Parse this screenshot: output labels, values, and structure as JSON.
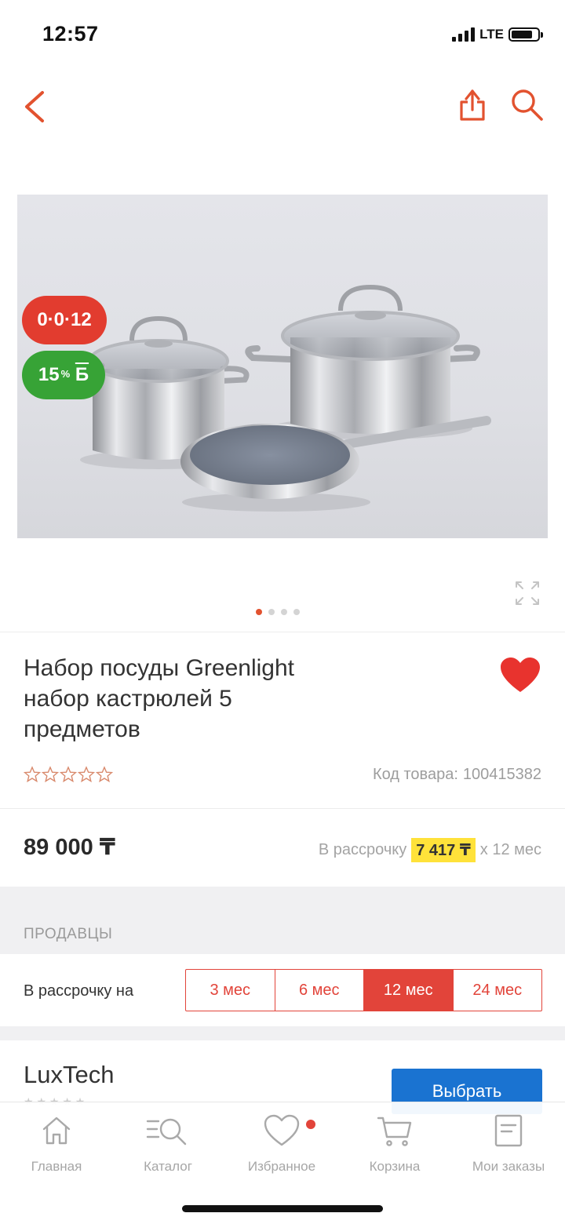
{
  "status_bar": {
    "time": "12:57",
    "network": "LTE"
  },
  "product": {
    "title": "Набор посуды Greenlight набор кастрюлей 5 предметов",
    "badges": {
      "installment": "0·0·12",
      "bonus_percent": "15",
      "bonus_unit": "%",
      "bonus_currency": "Б"
    },
    "gallery": {
      "image_count": 4,
      "active_index": 0
    },
    "rating": 0,
    "sku_label": "Код товара:",
    "sku_value": "100415382",
    "favorite": true,
    "price": "89 000 ₸",
    "installment_prefix": "В рассрочку",
    "installment_amount": "7 417 ₸",
    "installment_suffix": "x 12 мес"
  },
  "sellers": {
    "section_label": "ПРОДАВЦЫ",
    "term_label": "В рассрочку на",
    "terms": [
      "3 мес",
      "6 мес",
      "12 мес",
      "24 мес"
    ],
    "active_term_index": 2,
    "first_seller": {
      "name": "LuxTech",
      "button": "Выбрать"
    }
  },
  "tab_bar": {
    "items": [
      {
        "label": "Главная",
        "icon": "home-icon"
      },
      {
        "label": "Каталог",
        "icon": "catalog-search-icon"
      },
      {
        "label": "Избранное",
        "icon": "heart-icon"
      },
      {
        "label": "Корзина",
        "icon": "cart-icon"
      },
      {
        "label": "Мои заказы",
        "icon": "orders-icon"
      }
    ]
  },
  "colors": {
    "accent": "#e2443a",
    "bonus": "#37a336",
    "primary_button": "#1a73d1",
    "highlight": "#ffe23a"
  }
}
